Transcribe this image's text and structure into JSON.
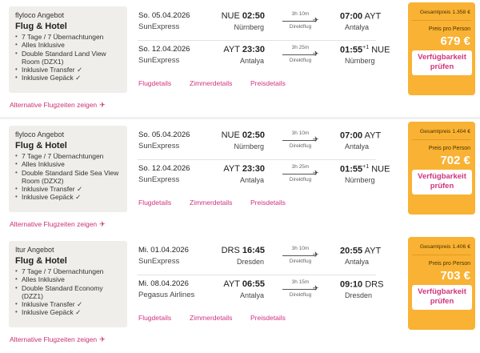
{
  "offers": [
    {
      "provider": "flyloco Angebot",
      "type": "Flug & Hotel",
      "features": [
        "7 Tage / 7 Übernachtungen",
        "Alles Inklusive",
        "Double Standard Land View Room (DZX1)",
        "Inklusive Transfer ✓",
        "Inklusive Gepäck ✓"
      ],
      "legs": [
        {
          "date": "So. 05.04.2026",
          "airline": "SunExpress",
          "dep_code": "NUE",
          "dep_time": "02:50",
          "dep_city": "Nürnberg",
          "duration": "3h 10m",
          "direct": "Direktflug",
          "arr_time": "07:00",
          "arr_code": "AYT",
          "arr_sup": "",
          "arr_city": "Antalya"
        },
        {
          "date": "So. 12.04.2026",
          "airline": "SunExpress",
          "dep_code": "AYT",
          "dep_time": "23:30",
          "dep_city": "Antalya",
          "duration": "3h 25m",
          "direct": "Direktflug",
          "arr_time": "01:55",
          "arr_code": "NUE",
          "arr_sup": "+1",
          "arr_city": "Nürnberg"
        }
      ],
      "links": [
        "Flugdetails",
        "Zimmerdetails",
        "Preisdetails"
      ],
      "total": "Gesamtpreis 1.358 €",
      "pp_label": "Preis pro Person",
      "pp": "679 €",
      "button": "Verfügbarkeit prüfen",
      "alt": "Alternative Flugzeiten zeigen"
    },
    {
      "provider": "flyloco Angebot",
      "type": "Flug & Hotel",
      "features": [
        "7 Tage / 7 Übernachtungen",
        "Alles Inklusive",
        "Double Standard Side Sea View Room (DZX2)",
        "Inklusive Transfer ✓",
        "Inklusive Gepäck ✓"
      ],
      "legs": [
        {
          "date": "So. 05.04.2026",
          "airline": "SunExpress",
          "dep_code": "NUE",
          "dep_time": "02:50",
          "dep_city": "Nürnberg",
          "duration": "3h 10m",
          "direct": "Direktflug",
          "arr_time": "07:00",
          "arr_code": "AYT",
          "arr_sup": "",
          "arr_city": "Antalya"
        },
        {
          "date": "So. 12.04.2026",
          "airline": "SunExpress",
          "dep_code": "AYT",
          "dep_time": "23:30",
          "dep_city": "Antalya",
          "duration": "3h 25m",
          "direct": "Direktflug",
          "arr_time": "01:55",
          "arr_code": "NUE",
          "arr_sup": "+1",
          "arr_city": "Nürnberg"
        }
      ],
      "links": [
        "Flugdetails",
        "Zimmerdetails",
        "Preisdetails"
      ],
      "total": "Gesamtpreis 1.404 €",
      "pp_label": "Preis pro Person",
      "pp": "702 €",
      "button": "Verfügbarkeit prüfen",
      "alt": "Alternative Flugzeiten zeigen"
    },
    {
      "provider": "Itur Angebot",
      "type": "Flug & Hotel",
      "features": [
        "7 Tage / 7 Übernachtungen",
        "Alles Inklusive",
        "Double Standard Economy (DZZ1)",
        "Inklusive Transfer ✓",
        "Inklusive Gepäck ✓"
      ],
      "legs": [
        {
          "date": "Mi. 01.04.2026",
          "airline": "SunExpress",
          "dep_code": "DRS",
          "dep_time": "16:45",
          "dep_city": "Dresden",
          "duration": "3h 10m",
          "direct": "Direktflug",
          "arr_time": "20:55",
          "arr_code": "AYT",
          "arr_sup": "",
          "arr_city": "Antalya"
        },
        {
          "date": "Mi. 08.04.2026",
          "airline": "Pegasus Airlines",
          "dep_code": "AYT",
          "dep_time": "06:55",
          "dep_city": "Antalya",
          "duration": "3h 15m",
          "direct": "Direktflug",
          "arr_time": "09:10",
          "arr_code": "DRS",
          "arr_sup": "",
          "arr_city": "Dresden"
        }
      ],
      "links": [
        "Flugdetails",
        "Zimmerdetails",
        "Preisdetails"
      ],
      "total": "Gesamtpreis 1.406 €",
      "pp_label": "Preis pro Person",
      "pp": "703 €",
      "button": "Verfügbarkeit prüfen",
      "alt": "Alternative Flugzeiten zeigen"
    }
  ],
  "colors": {
    "accent": "#d0337f",
    "price_box": "#f9b233",
    "offer_box": "#f0eeea",
    "background": "#f1f1f1"
  },
  "icons": {
    "plane": "airplane-icon"
  }
}
